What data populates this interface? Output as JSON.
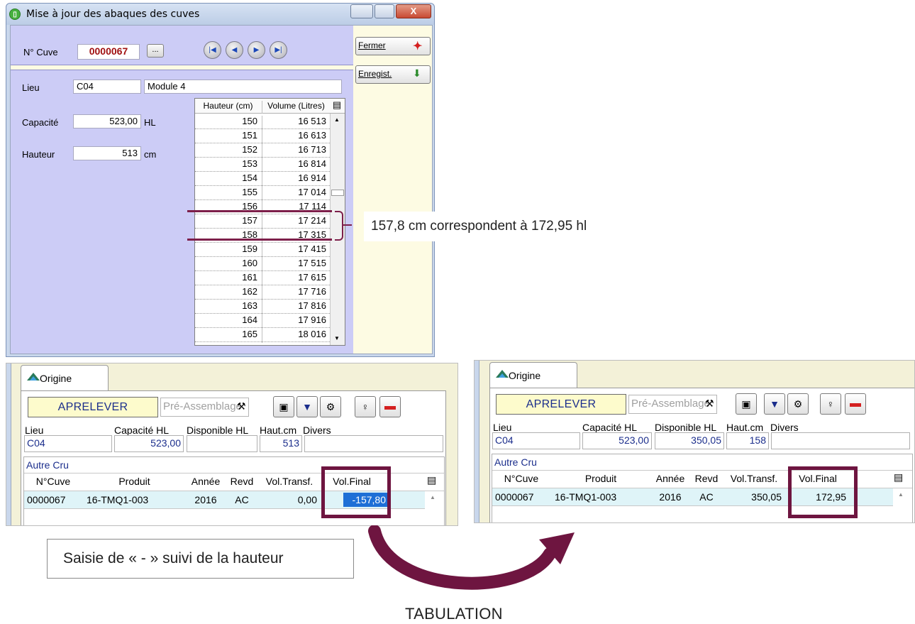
{
  "window": {
    "title": "Mise à jour des abaques des cuves",
    "close_glyph": "X"
  },
  "cuve": {
    "label": "N° Cuve",
    "value": "0000067",
    "browse": "...",
    "nav": [
      "|◀",
      "◀",
      "▶",
      "▶|"
    ]
  },
  "buttons": {
    "fermer": "Fermer",
    "enregist": "Enregist."
  },
  "info": {
    "lieu_label": "Lieu",
    "lieu_code": "C04",
    "lieu_name": "Module 4",
    "capacite_label": "Capacité",
    "capacite_value": "523,00",
    "capacite_unit": "HL",
    "hauteur_label": "Hauteur",
    "hauteur_value": "513",
    "hauteur_unit": "cm"
  },
  "abaque": {
    "headers": [
      "Hauteur (cm)",
      "Volume (Litres)"
    ],
    "rows": [
      [
        "150",
        "16 513"
      ],
      [
        "151",
        "16 613"
      ],
      [
        "152",
        "16 713"
      ],
      [
        "153",
        "16 814"
      ],
      [
        "154",
        "16 914"
      ],
      [
        "155",
        "17 014"
      ],
      [
        "156",
        "17 114"
      ],
      [
        "157",
        "17 214"
      ],
      [
        "158",
        "17 315"
      ],
      [
        "159",
        "17 415"
      ],
      [
        "160",
        "17 515"
      ],
      [
        "161",
        "17 615"
      ],
      [
        "162",
        "17 716"
      ],
      [
        "163",
        "17 816"
      ],
      [
        "164",
        "17 916"
      ],
      [
        "165",
        "18 016"
      ]
    ]
  },
  "annotation": "157,8 cm correspondent à 172,95 hl",
  "before": {
    "tab": "Origine",
    "aprelever": "APRELEVER",
    "preassemblage": "Pré-Assemblage",
    "headers": {
      "lieu": "Lieu",
      "capacite": "Capacité HL",
      "disponible": "Disponible HL",
      "haut": "Haut.cm",
      "divers": "Divers"
    },
    "values": {
      "lieu": "C04",
      "capacite": "523,00",
      "disponible": "",
      "haut": "513",
      "divers": ""
    },
    "autre_cru": "Autre Cru",
    "cols": [
      "N°Cuve",
      "Produit",
      "Année",
      "Revd",
      "Vol.Transf.",
      "Vol.Final"
    ],
    "row": [
      "0000067",
      "16-TMQ1-003",
      "2016",
      "AC",
      "0,00",
      "-157,80"
    ]
  },
  "after": {
    "tab": "Origine",
    "aprelever": "APRELEVER",
    "preassemblage": "Pré-Assemblage",
    "headers": {
      "lieu": "Lieu",
      "capacite": "Capacité HL",
      "disponible": "Disponible HL",
      "haut": "Haut.cm",
      "divers": "Divers"
    },
    "values": {
      "lieu": "C04",
      "capacite": "523,00",
      "disponible": "350,05",
      "haut": "158",
      "divers": ""
    },
    "autre_cru": "Autre Cru",
    "cols": [
      "N°Cuve",
      "Produit",
      "Année",
      "Revd",
      "Vol.Transf.",
      "Vol.Final"
    ],
    "row": [
      "0000067",
      "16-TMQ1-003",
      "2016",
      "AC",
      "350,05",
      "172,95"
    ]
  },
  "caption": "Saisie de « - » suivi de la hauteur",
  "arrow_label": "TABULATION",
  "colors": {
    "accent": "#6e1540",
    "panel": "#ccccf6",
    "highlight": "#1e6fd6"
  }
}
